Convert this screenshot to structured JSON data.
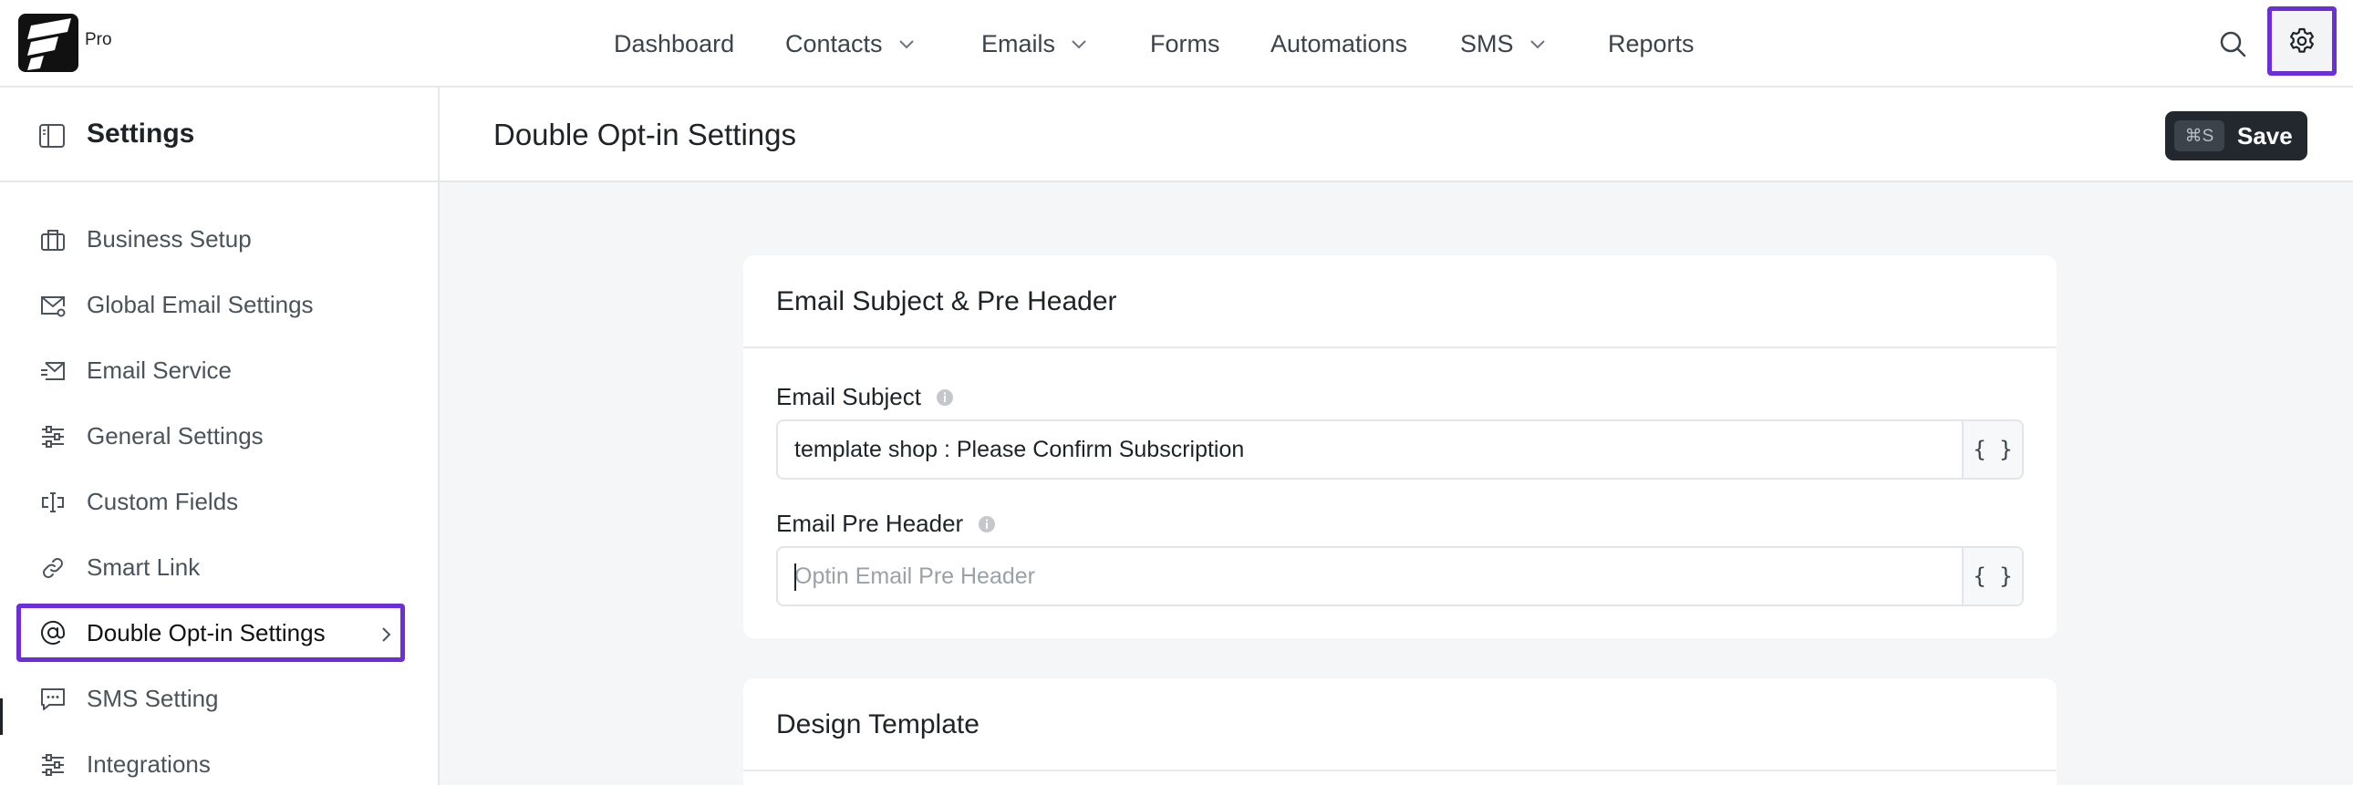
{
  "app": {
    "badge": "Pro"
  },
  "nav": {
    "items": [
      {
        "label": "Dashboard",
        "has_dropdown": false
      },
      {
        "label": "Contacts",
        "has_dropdown": true
      },
      {
        "label": "Emails",
        "has_dropdown": true
      },
      {
        "label": "Forms",
        "has_dropdown": false
      },
      {
        "label": "Automations",
        "has_dropdown": false
      },
      {
        "label": "SMS",
        "has_dropdown": true
      },
      {
        "label": "Reports",
        "has_dropdown": false
      }
    ],
    "icons": [
      "search-icon",
      "gear-icon"
    ]
  },
  "sidebar": {
    "title": "Settings",
    "items": [
      {
        "label": "Business Setup",
        "icon": "briefcase-icon"
      },
      {
        "label": "Global Email Settings",
        "icon": "mail-gear-icon"
      },
      {
        "label": "Email Service",
        "icon": "mail-send-icon"
      },
      {
        "label": "General Settings",
        "icon": "sliders-icon"
      },
      {
        "label": "Custom Fields",
        "icon": "text-cursor-icon"
      },
      {
        "label": "Smart Link",
        "icon": "link-icon"
      },
      {
        "label": "Double Opt-in Settings",
        "icon": "at-sign-icon",
        "active": true
      },
      {
        "label": "SMS Setting",
        "icon": "message-icon"
      },
      {
        "label": "Integrations",
        "icon": "sliders-icon"
      }
    ]
  },
  "main": {
    "title": "Double Opt-in Settings",
    "save": {
      "shortcut": "⌘S",
      "label": "Save"
    },
    "section_subject": {
      "title": "Email Subject & Pre Header",
      "email_subject": {
        "label": "Email Subject",
        "value": "template shop : Please Confirm Subscription",
        "shortcode": "{ }"
      },
      "pre_header": {
        "label": "Email Pre Header",
        "value": "",
        "placeholder": "Optin Email Pre Header",
        "shortcode": "{ }"
      }
    },
    "section_design": {
      "title": "Design Template"
    }
  },
  "colors": {
    "accent_highlight": "#6b2fd9",
    "save_button": "#23282f",
    "page_background": "#f5f6f8"
  }
}
